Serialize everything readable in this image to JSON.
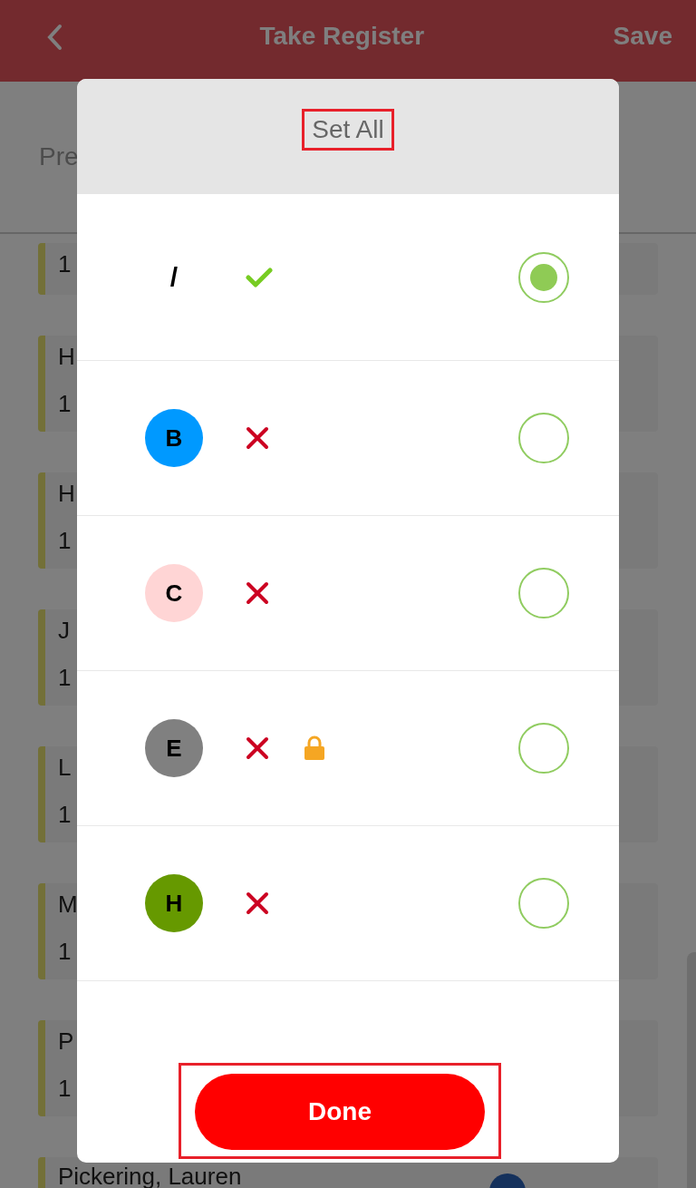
{
  "app_bar": {
    "title": "Take Register",
    "action": "Save"
  },
  "subheader": {
    "text": "Pre"
  },
  "rows": [
    {
      "name": "",
      "time": "1"
    },
    {
      "name": "H",
      "time": "1"
    },
    {
      "name": "H",
      "time": "1"
    },
    {
      "name": "J",
      "time": "1"
    },
    {
      "name": "L",
      "time": "1"
    },
    {
      "name": "M",
      "time": "1"
    },
    {
      "name": "P",
      "time": "1"
    },
    {
      "name": "Pickering, Lauren",
      "time": ""
    }
  ],
  "dialog": {
    "title": "Set All",
    "options": [
      {
        "code": "/",
        "kind": "plain",
        "present": true,
        "locked": false,
        "selected": true
      },
      {
        "code": "B",
        "kind": "badge",
        "color": "#0099ff",
        "present": false,
        "locked": false,
        "selected": false
      },
      {
        "code": "C",
        "kind": "badge",
        "color": "#ffd5d5",
        "present": false,
        "locked": false,
        "selected": false
      },
      {
        "code": "E",
        "kind": "badge",
        "color": "#808080",
        "present": false,
        "locked": true,
        "selected": false
      },
      {
        "code": "H",
        "kind": "badge",
        "color": "#669900",
        "present": false,
        "locked": false,
        "selected": false
      }
    ],
    "done": "Done"
  }
}
